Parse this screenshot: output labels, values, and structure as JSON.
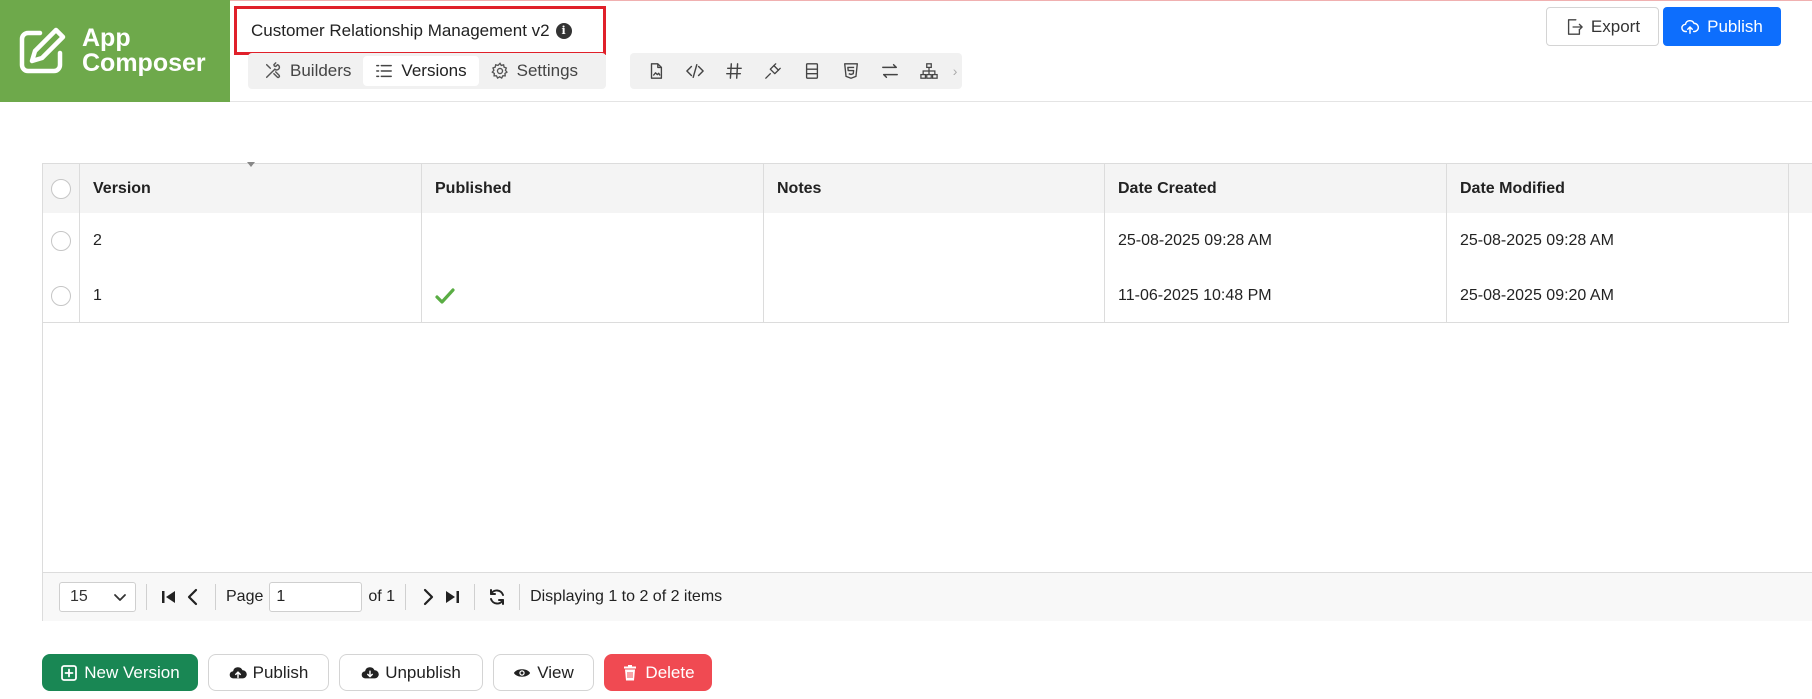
{
  "app": {
    "logo_line1": "App",
    "logo_line2": "Composer",
    "title": "Customer Relationship Management v2",
    "brand_color": "#6ea94b"
  },
  "tabs": [
    {
      "label": "Builders",
      "icon": "tools-icon",
      "active": false
    },
    {
      "label": "Versions",
      "icon": "list-icon",
      "active": true
    },
    {
      "label": "Settings",
      "icon": "gear-icon",
      "active": false
    }
  ],
  "toolbar_icons": [
    "file-image-icon",
    "code-icon",
    "hash-icon",
    "plug-icon",
    "layout-icon",
    "html5-icon",
    "arrows-exchange-icon",
    "sitemap-icon"
  ],
  "header_buttons": {
    "export": "Export",
    "publish": "Publish",
    "publish_color": "#0d6efd"
  },
  "grid": {
    "columns": [
      "Version",
      "Published",
      "Notes",
      "Date Created",
      "Date Modified"
    ],
    "rows": [
      {
        "version": "2",
        "published": false,
        "notes": "",
        "date_created": "25-08-2025 09:28 AM",
        "date_modified": "25-08-2025 09:28 AM"
      },
      {
        "version": "1",
        "published": true,
        "notes": "",
        "date_created": "11-06-2025 10:48 PM",
        "date_modified": "25-08-2025 09:20 AM"
      }
    ]
  },
  "pager": {
    "page_size": "15",
    "page_label": "Page",
    "page_value": "1",
    "of_label": "of 1",
    "status": "Displaying 1 to 2 of 2 items"
  },
  "actions": {
    "new_version": "New Version",
    "publish": "Publish",
    "unpublish": "Unpublish",
    "view": "View",
    "delete": "Delete",
    "new_version_color": "#198754",
    "delete_color": "#f04a52"
  }
}
